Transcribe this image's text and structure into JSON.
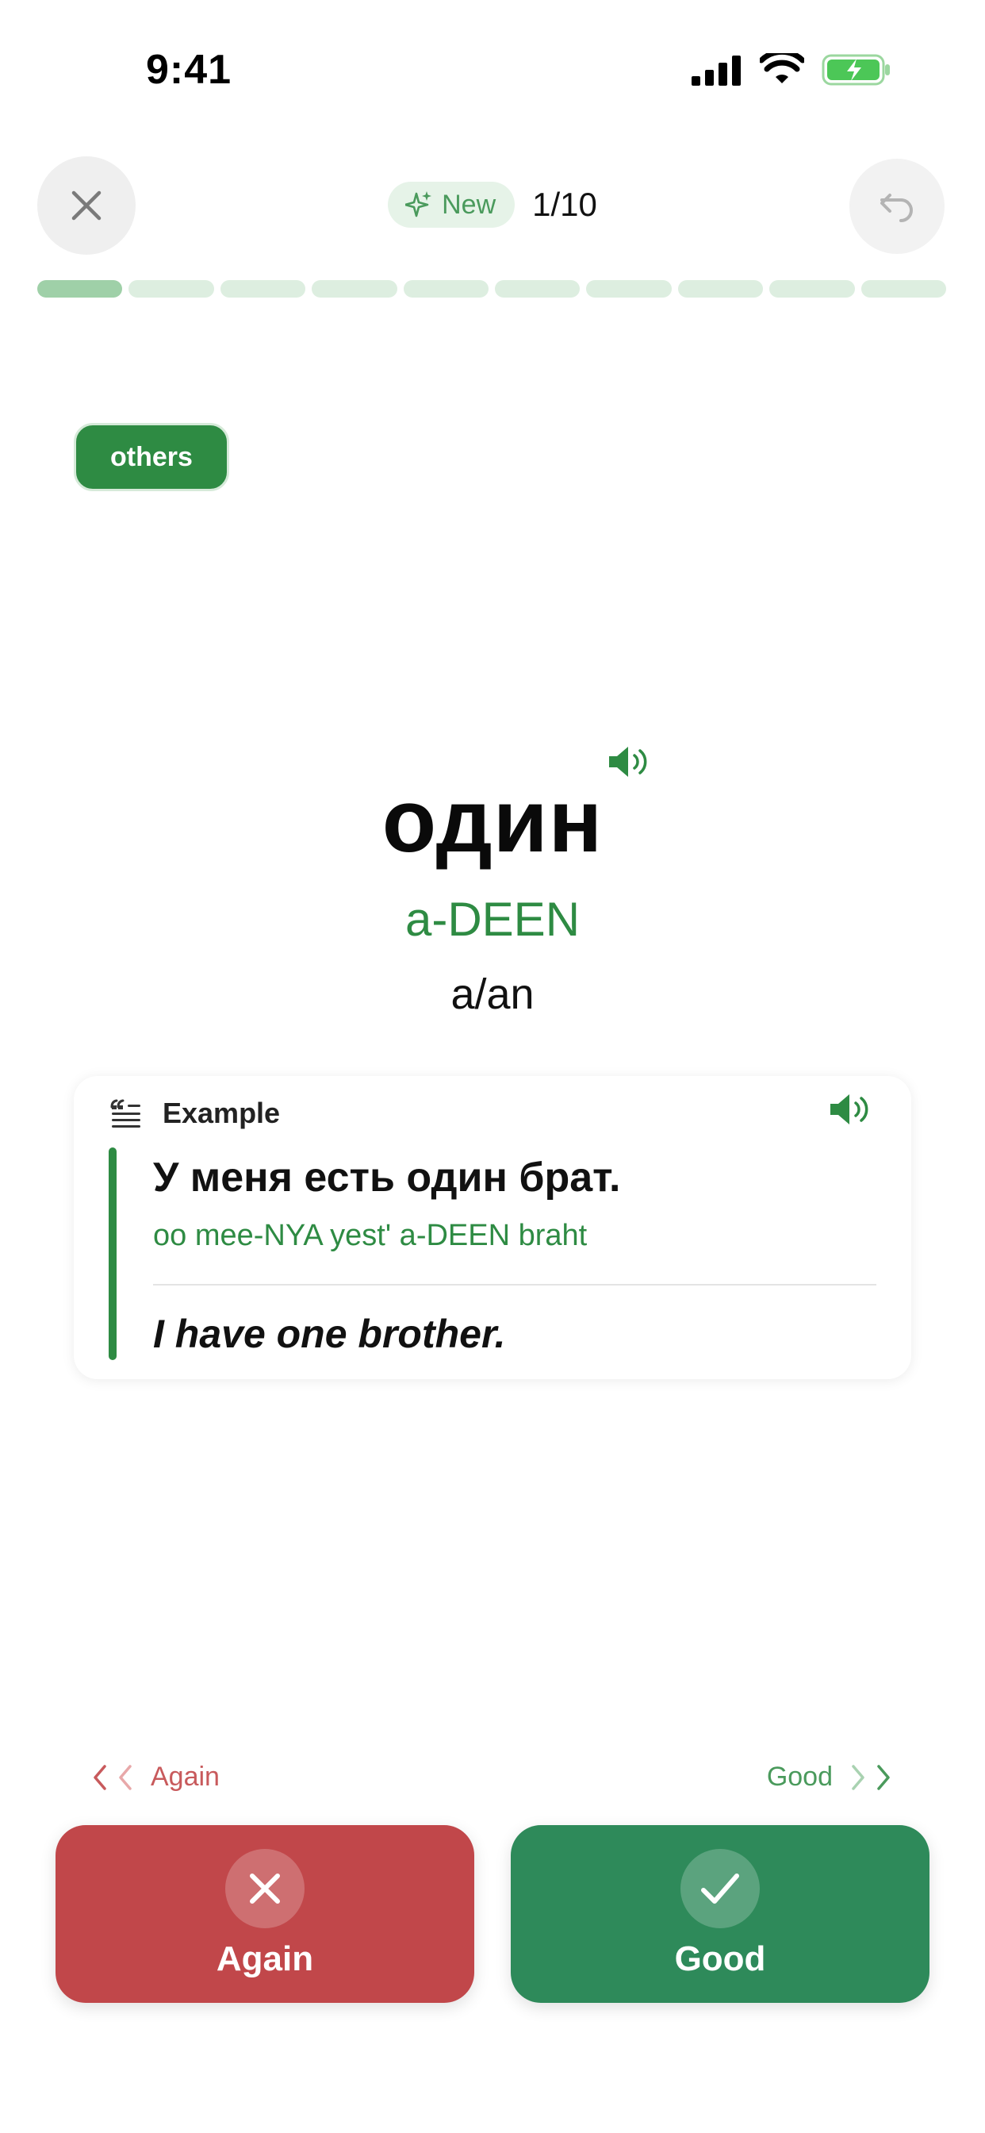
{
  "status_bar": {
    "time": "9:41"
  },
  "header": {
    "badge_label": "New",
    "counter": "1/10"
  },
  "progress": {
    "current": 1,
    "total": 10
  },
  "card": {
    "tag": "others",
    "word": "один",
    "pronunciation": "a-DEEN",
    "translation": "a/an"
  },
  "example": {
    "title": "Example",
    "sentence": "У меня есть один брат.",
    "pronunciation": "oo mee-NYA yest' a-DEEN braht",
    "translation": "I have one brother."
  },
  "hints": {
    "left": "Again",
    "right": "Good"
  },
  "actions": {
    "again_label": "Again",
    "good_label": "Good"
  },
  "colors": {
    "accent_green": "#2e8b43",
    "again_red": "#c1474a",
    "good_green": "#2e8a5a",
    "progress_done": "#9fd0a8",
    "progress_pending": "#ddeee0"
  }
}
